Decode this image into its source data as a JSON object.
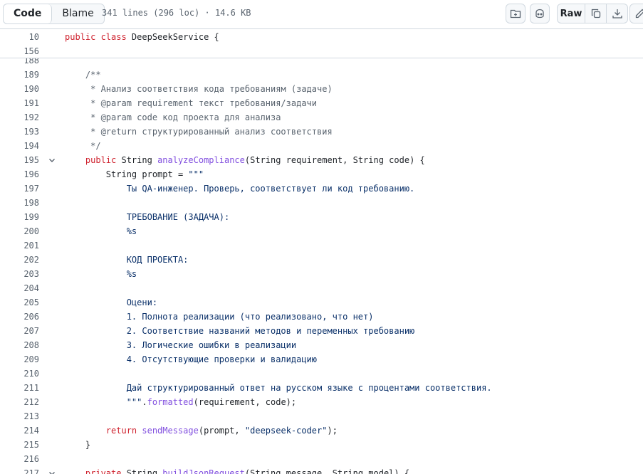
{
  "toolbar": {
    "tabs": [
      {
        "label": "Code",
        "active": true
      },
      {
        "label": "Blame",
        "active": false
      }
    ],
    "file_info": "341 lines (296 loc) · 14.6 KB",
    "raw_label": "Raw",
    "icons": [
      "symbols-icon",
      "copilot-icon",
      "copy-icon",
      "download-icon",
      "edit-icon"
    ]
  },
  "sticky": [
    {
      "num": "10",
      "tokens": [
        {
          "t": "kw",
          "v": "public class "
        },
        {
          "t": "tx",
          "v": "DeepSeekService {"
        }
      ]
    },
    {
      "num": "156",
      "tokens": []
    }
  ],
  "lines": [
    {
      "num": "188",
      "tokens": []
    },
    {
      "num": "189",
      "tokens": [
        {
          "t": "cm",
          "v": "    /**"
        }
      ]
    },
    {
      "num": "190",
      "tokens": [
        {
          "t": "cm",
          "v": "     * Анализ соответствия кода требованиям (задаче)"
        }
      ]
    },
    {
      "num": "191",
      "tokens": [
        {
          "t": "cm",
          "v": "     * @param requirement текст требования/задачи"
        }
      ]
    },
    {
      "num": "192",
      "tokens": [
        {
          "t": "cm",
          "v": "     * @param code код проекта для анализа"
        }
      ]
    },
    {
      "num": "193",
      "tokens": [
        {
          "t": "cm",
          "v": "     * @return структурированный анализ соответствия"
        }
      ]
    },
    {
      "num": "194",
      "tokens": [
        {
          "t": "cm",
          "v": "     */"
        }
      ]
    },
    {
      "num": "195",
      "fold": true,
      "tokens": [
        {
          "t": "tx",
          "v": "    "
        },
        {
          "t": "kw",
          "v": "public "
        },
        {
          "t": "tx",
          "v": "String "
        },
        {
          "t": "fn",
          "v": "analyzeCompliance"
        },
        {
          "t": "tx",
          "v": "(String requirement, String code) {"
        }
      ]
    },
    {
      "num": "196",
      "tokens": [
        {
          "t": "tx",
          "v": "        String prompt = "
        },
        {
          "t": "str",
          "v": "\"\"\""
        }
      ]
    },
    {
      "num": "197",
      "tokens": [
        {
          "t": "str",
          "v": "            Ты QA-инженер. Проверь, соответствует ли код требованию."
        }
      ]
    },
    {
      "num": "198",
      "tokens": []
    },
    {
      "num": "199",
      "tokens": [
        {
          "t": "str",
          "v": "            ТРЕБОВАНИЕ (ЗАДАЧА):"
        }
      ]
    },
    {
      "num": "200",
      "tokens": [
        {
          "t": "str",
          "v": "            %s"
        }
      ]
    },
    {
      "num": "201",
      "tokens": []
    },
    {
      "num": "202",
      "tokens": [
        {
          "t": "str",
          "v": "            КОД ПРОЕКТА:"
        }
      ]
    },
    {
      "num": "203",
      "tokens": [
        {
          "t": "str",
          "v": "            %s"
        }
      ]
    },
    {
      "num": "204",
      "tokens": []
    },
    {
      "num": "205",
      "tokens": [
        {
          "t": "str",
          "v": "            Оцени:"
        }
      ]
    },
    {
      "num": "206",
      "tokens": [
        {
          "t": "str",
          "v": "            1. Полнота реализации (что реализовано, что нет)"
        }
      ]
    },
    {
      "num": "207",
      "tokens": [
        {
          "t": "str",
          "v": "            2. Соответствие названий методов и переменных требованию"
        }
      ]
    },
    {
      "num": "208",
      "tokens": [
        {
          "t": "str",
          "v": "            3. Логические ошибки в реализации"
        }
      ]
    },
    {
      "num": "209",
      "tokens": [
        {
          "t": "str",
          "v": "            4. Отсутствующие проверки и валидацию"
        }
      ]
    },
    {
      "num": "210",
      "tokens": []
    },
    {
      "num": "211",
      "tokens": [
        {
          "t": "str",
          "v": "            Дай структурированный ответ на русском языке с процентами соответствия."
        }
      ]
    },
    {
      "num": "212",
      "tokens": [
        {
          "t": "str",
          "v": "            \"\"\""
        },
        {
          "t": "tx",
          "v": "."
        },
        {
          "t": "fn",
          "v": "formatted"
        },
        {
          "t": "tx",
          "v": "(requirement, code);"
        }
      ]
    },
    {
      "num": "213",
      "tokens": []
    },
    {
      "num": "214",
      "tokens": [
        {
          "t": "tx",
          "v": "        "
        },
        {
          "t": "kw",
          "v": "return "
        },
        {
          "t": "fn",
          "v": "sendMessage"
        },
        {
          "t": "tx",
          "v": "(prompt, "
        },
        {
          "t": "str",
          "v": "\"deepseek-coder\""
        },
        {
          "t": "tx",
          "v": ");"
        }
      ]
    },
    {
      "num": "215",
      "tokens": [
        {
          "t": "tx",
          "v": "    }"
        }
      ]
    },
    {
      "num": "216",
      "tokens": []
    },
    {
      "num": "217",
      "fold": true,
      "tokens": [
        {
          "t": "tx",
          "v": "    "
        },
        {
          "t": "kw",
          "v": "private "
        },
        {
          "t": "tx",
          "v": "String "
        },
        {
          "t": "fn",
          "v": "buildJsonRequest"
        },
        {
          "t": "tx",
          "v": "(String message, String model) {"
        }
      ]
    }
  ]
}
